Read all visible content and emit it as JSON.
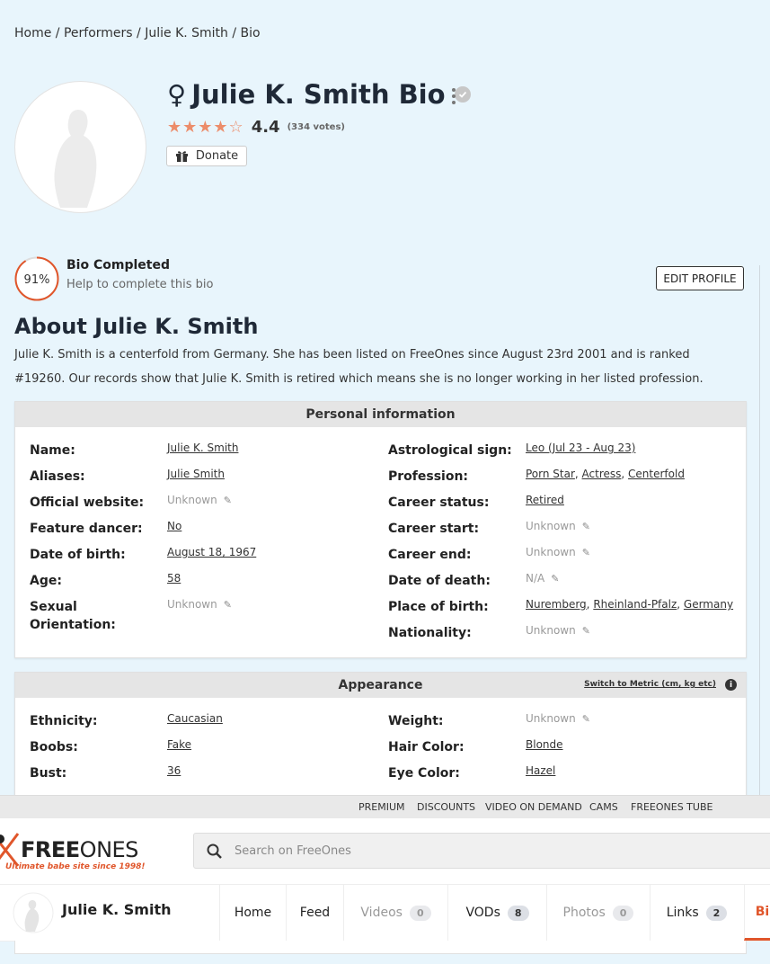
{
  "breadcrumb": [
    "Home",
    "/",
    "Performers",
    "/",
    "Julie K. Smith",
    "/",
    "Bio"
  ],
  "profile": {
    "gender_symbol": "♀",
    "title": "Julie K. Smith Bio",
    "rating": "4.4",
    "votes": "(334 votes)",
    "stars": "★★★★",
    "half_star": "☆",
    "donate_label": "Donate"
  },
  "bio_completion": {
    "percent": "91%",
    "percent_value": 91,
    "title": "Bio Completed",
    "help": "Help to complete this bio",
    "edit_label": "EDIT PROFILE"
  },
  "about": {
    "title": "About Julie K. Smith",
    "text": "Julie K. Smith is a centerfold from Germany. She has been listed on FreeOnes since August 23rd 2001 and is ranked #19260. Our records show that Julie K. Smith is retired which means she is no longer working in her listed profession."
  },
  "personal": {
    "heading": "Personal information",
    "left": [
      {
        "label": "Name:",
        "value": "Julie K. Smith",
        "type": "link"
      },
      {
        "label": "Aliases:",
        "value": "Julie Smith",
        "type": "link"
      },
      {
        "label": "Official website:",
        "value": "Unknown",
        "type": "unknown"
      },
      {
        "label": "Feature dancer:",
        "value": "No",
        "type": "link"
      },
      {
        "label": "Date of birth:",
        "value": "August 18, 1967",
        "type": "link"
      },
      {
        "label": "Age:",
        "value": "58",
        "type": "link"
      },
      {
        "label": "Sexual",
        "label2": "Orientation:",
        "value": "Unknown",
        "type": "unknown"
      }
    ],
    "right": [
      {
        "label": "Astrological sign:",
        "value": "Leo (Jul 23 - Aug 23)",
        "type": "link"
      },
      {
        "label": "Profession:",
        "links": [
          "Porn Star",
          "Actress",
          "Centerfold"
        ],
        "type": "links"
      },
      {
        "label": "Career status:",
        "value": "Retired",
        "type": "link"
      },
      {
        "label": "Career start:",
        "value": "Unknown",
        "type": "unknown"
      },
      {
        "label": "Career end:",
        "value": "Unknown",
        "type": "unknown"
      },
      {
        "label": "Date of death:",
        "value": "N/A",
        "type": "unknown"
      },
      {
        "label": "Place of birth:",
        "links": [
          "Nuremberg",
          "Rheinland-Pfalz",
          "Germany"
        ],
        "type": "links"
      },
      {
        "label": "Nationality:",
        "value": "Unknown",
        "type": "unknown"
      }
    ]
  },
  "appearance": {
    "heading": "Appearance",
    "metric_link": "Switch to Metric (cm, kg etc)",
    "info_icon": "i",
    "left": [
      {
        "label": "Ethnicity:",
        "value": "Caucasian",
        "type": "link"
      },
      {
        "label": "Boobs:",
        "value": "Fake",
        "type": "link"
      },
      {
        "label": "Bust:",
        "value": "36",
        "type": "link"
      }
    ],
    "right": [
      {
        "label": "Weight:",
        "value": "Unknown",
        "type": "unknown"
      },
      {
        "label": "Hair Color:",
        "value": "Blonde",
        "type": "link"
      },
      {
        "label": "Eye Color:",
        "value": "Hazel",
        "type": "link"
      }
    ]
  },
  "topnav": [
    "PREMIUM",
    "DISCOUNTS",
    "VIDEO ON DEMAND",
    "CAMS",
    "FREEONES TUBE"
  ],
  "logo": {
    "main": "FREE",
    "light": "ONES",
    "tagline": "Ultimate babe site since 1998!"
  },
  "search": {
    "placeholder": "Search on FreeOnes"
  },
  "subnav": {
    "name": "Julie K. Smith",
    "tabs": [
      {
        "label": "Home",
        "count": null,
        "state": "normal"
      },
      {
        "label": "Feed",
        "count": null,
        "state": "normal"
      },
      {
        "label": "Videos",
        "count": "0",
        "state": "disabled"
      },
      {
        "label": "VODs",
        "count": "8",
        "state": "normal"
      },
      {
        "label": "Photos",
        "count": "0",
        "state": "disabled"
      },
      {
        "label": "Links",
        "count": "2",
        "state": "normal"
      },
      {
        "label": "Bi",
        "count": null,
        "state": "active"
      }
    ]
  },
  "icons": {
    "verified": "check-circle-icon",
    "kebab": "more-vertical-icon",
    "gift": "gift-icon",
    "pencil": "pencil-icon",
    "search": "search-icon"
  },
  "colors": {
    "accent": "#e0562b",
    "star": "#ec8c6a",
    "background": "#e8f5fc"
  }
}
